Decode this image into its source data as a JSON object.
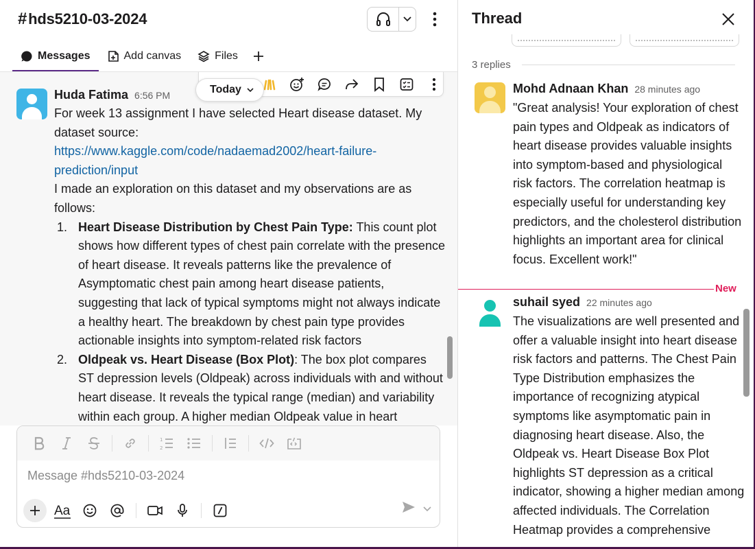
{
  "colors": {
    "accent": "#5b2a86",
    "link": "#1264a3",
    "new_marker": "#e01e5a",
    "avatar_huda": "#3fb5e6",
    "avatar_mohd": "#f3c94a",
    "avatar_suhail": "#17c3b2"
  },
  "channel": {
    "hash": "#",
    "name": "hds5210-03-2024",
    "icons": {
      "huddle": "headphones-icon",
      "caret": "chevron-down-icon",
      "more": "kebab-icon"
    }
  },
  "tabs": [
    {
      "label": "Messages",
      "icon": "message-bubble-icon",
      "active": true
    },
    {
      "label": "Add canvas",
      "icon": "canvas-icon",
      "active": false
    },
    {
      "label": "Files",
      "icon": "layers-icon",
      "active": false
    }
  ],
  "date_pill": {
    "label": "Today"
  },
  "message": {
    "author": "Huda Fatima",
    "time": "6:56 PM",
    "intro": "For week 13 assignment I have selected Heart disease dataset. My dataset source:",
    "link": "https://www.kaggle.com/code/nadaemad2002/heart-failure-prediction/input",
    "para2": "I made an exploration on this dataset and my observations are as follows:",
    "items": [
      {
        "num": "1.",
        "bold": "Heart Disease Distribution by Chest Pain Type:",
        "text": " This count plot shows how different types of chest pain correlate with the presence of heart disease. It reveals patterns like the prevalence of Asymptomatic chest pain among heart disease patients, suggesting that lack of typical symptoms might not always indicate a healthy heart. The breakdown by chest pain type provides actionable insights into symptom-related risk factors"
      },
      {
        "num": "2.",
        "bold": "Oldpeak vs. Heart Disease (Box Plot)",
        "text": ": The box plot compares ST depression levels (Oldpeak) across individuals with and without heart disease. It reveals the typical range (median) and variability within each group. A higher median Oldpeak value in heart"
      }
    ]
  },
  "composer": {
    "placeholder": "Message #hds5210-03-2024",
    "format_tools": [
      "bold-icon",
      "italic-icon",
      "strikethrough-icon",
      "link-icon",
      "ordered-list-icon",
      "bullet-list-icon",
      "blockquote-icon",
      "code-icon",
      "code-block-icon"
    ],
    "actions": [
      "plus-icon",
      "formatting-icon",
      "emoji-icon",
      "mention-icon",
      "video-icon",
      "microphone-icon",
      "slash-command-icon"
    ],
    "send": "send-icon"
  },
  "thread": {
    "title": "Thread",
    "replies_count": "3 replies",
    "new_label": "New",
    "replies": [
      {
        "author": "Mohd Adnaan Khan",
        "time": "28 minutes ago",
        "text": "\"Great analysis! Your exploration of chest pain types and Oldpeak as indicators of heart disease provides valuable insights into symptom-based and physiological risk factors. The correlation heatmap is especially useful for understanding key predictors, and the cholesterol distribution highlights an important area for clinical focus. Excellent work!\""
      },
      {
        "author": "suhail syed",
        "time": "22 minutes ago",
        "text": "The visualizations are well presented and offer a valuable insight into heart disease risk factors and patterns. The Chest Pain Type Distribution emphasizes the importance of recognizing atypical symptoms like asymptomatic pain in diagnosing heart disease. Also, the Oldpeak vs. Heart Disease Box Plot highlights ST depression as a critical indicator, showing a higher median among affected individuals. The Correlation Heatmap provides a comprehensive"
      }
    ]
  }
}
